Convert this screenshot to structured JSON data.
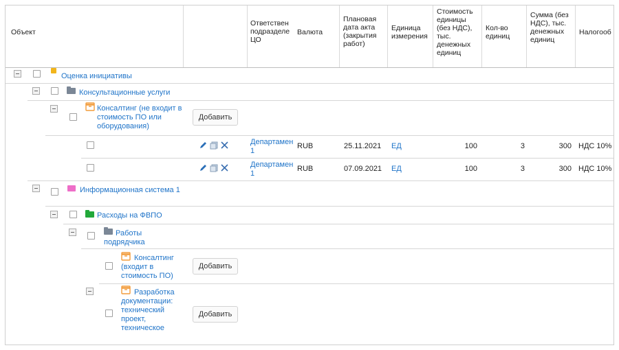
{
  "header": {
    "object": "Объект",
    "responsible": "Ответствен подразделе ЦО",
    "currency": "Валюта",
    "planned_date": "Плановая дата акта (закрытия работ)",
    "unit": "Единица измерения",
    "unit_cost": "Стоимость единицы (без НДС), тыс. денежных единиц",
    "quantity": "Кол-во единиц",
    "sum": "Сумма (без НДС), тыс. денежных единиц",
    "tax": "Налогооб"
  },
  "tree": {
    "initiative": "Оценка инициативы",
    "consulting_services": "Консультационные услуги",
    "consulting_not_included": "Консалтинг (не входит в стоимость ПО или оборудования)",
    "info_system": "Информационная система 1",
    "fvpo_expenses": "Расходы на ФВПО",
    "contractor_works": "Работы подрядчика",
    "consulting_included": "Консалтинг (входит в стоимость ПО)",
    "doc_development": "Разработка документации: технический проект, техническое"
  },
  "add_label": "Добавить",
  "rows": [
    {
      "department": "Департамен 1",
      "currency": "RUB",
      "date": "25.11.2021",
      "unit": "ЕД",
      "unit_cost": "100",
      "quantity": "3",
      "sum": "300",
      "tax": "НДС 10%"
    },
    {
      "department": "Департамен 1",
      "currency": "RUB",
      "date": "07.09.2021",
      "unit": "ЕД",
      "unit_cost": "100",
      "quantity": "3",
      "sum": "300",
      "tax": "НДС 10%"
    }
  ],
  "colors": {
    "link": "#1e73c8",
    "initiative_icon": "#f2b51b",
    "system_icon": "#ee6ec8",
    "folder_gray": "#7b8796",
    "folder_green": "#22a83a",
    "item_icon": "#f29b3a"
  },
  "icons": {
    "edit": "pencil-icon",
    "copy": "copy-icon",
    "delete": "close-icon"
  }
}
